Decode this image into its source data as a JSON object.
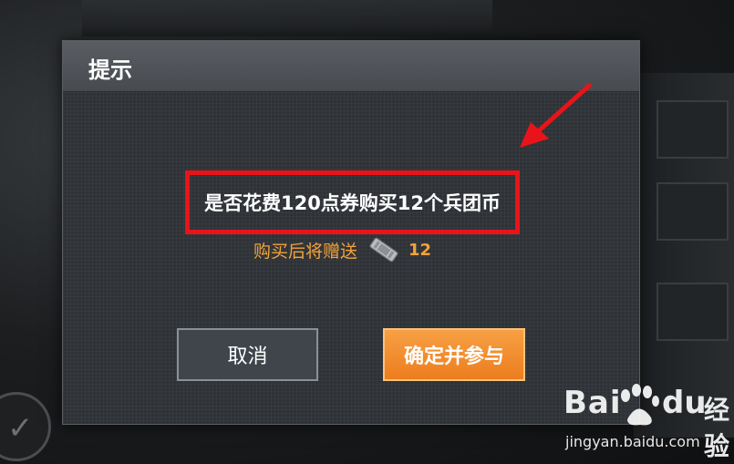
{
  "dialog": {
    "title": "提示",
    "question": "是否花费120点券购买12个兵团币",
    "reward_text": "购买后将赠送",
    "reward_count": "12",
    "reward_icon": "silver-ticket-icon",
    "cancel_label": "取消",
    "confirm_label": "确定并参与"
  },
  "colors": {
    "highlight_box": "#e8141a",
    "reward_text": "#f3a23a",
    "confirm_button": "#ef8a2a",
    "annotation_arrow": "#e8141a"
  },
  "watermark": {
    "logo_left": "Bai",
    "logo_right": "du",
    "brand_text": "经验",
    "url": "jingyan.baidu.com"
  }
}
